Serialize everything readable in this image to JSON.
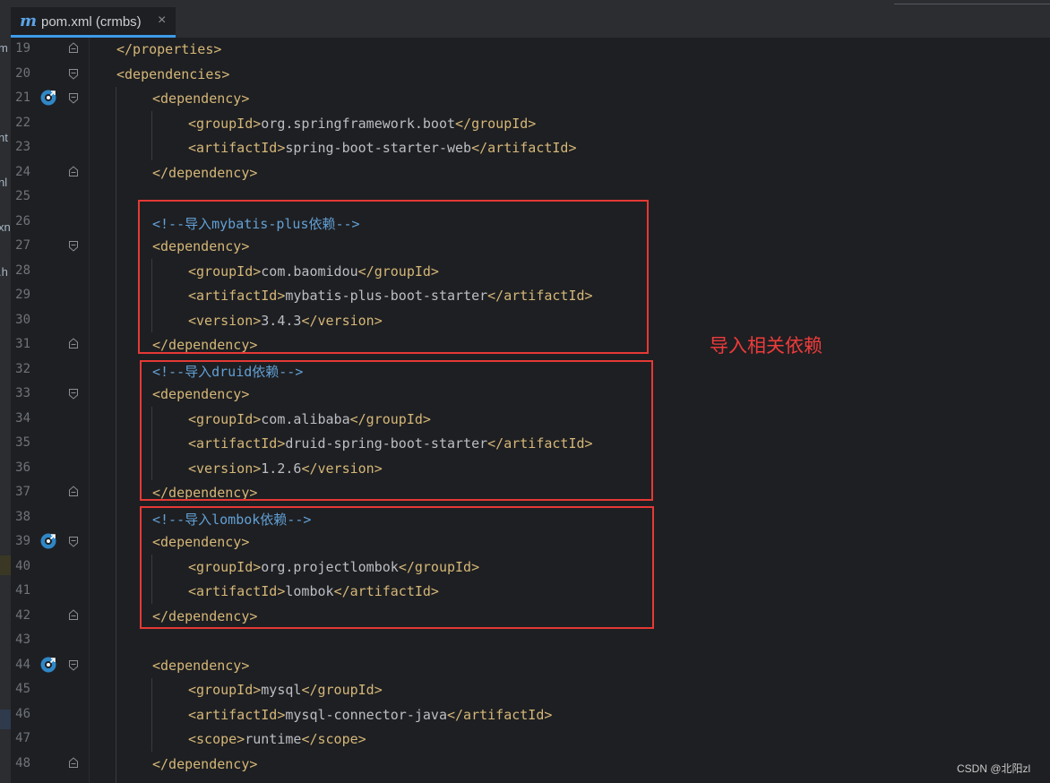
{
  "tab": {
    "icon": "maven-m-icon",
    "letter": "m",
    "label": "pom.xml (crmbs)",
    "close": "×"
  },
  "left_fragments": [
    "m",
    "nt",
    "nl",
    "xn",
    ".h"
  ],
  "lines": [
    {
      "n": "19",
      "fold": "end",
      "indent": 1,
      "parts": [
        [
          "tag",
          "</properties>"
        ]
      ]
    },
    {
      "n": "20",
      "fold": "start",
      "indent": 1,
      "parts": [
        [
          "tag",
          "<dependencies>"
        ]
      ]
    },
    {
      "n": "21",
      "fold": "start",
      "mark": true,
      "indent": 2,
      "parts": [
        [
          "tag",
          "<dependency>"
        ]
      ]
    },
    {
      "n": "22",
      "indent": 3,
      "parts": [
        [
          "tag",
          "<groupId>"
        ],
        [
          "txt",
          "org.springframework.boot"
        ],
        [
          "tag",
          "</groupId>"
        ]
      ]
    },
    {
      "n": "23",
      "indent": 3,
      "parts": [
        [
          "tag",
          "<artifactId>"
        ],
        [
          "txt",
          "spring-boot-starter-web"
        ],
        [
          "tag",
          "</artifactId>"
        ]
      ]
    },
    {
      "n": "24",
      "fold": "end",
      "indent": 2,
      "parts": [
        [
          "tag",
          "</dependency>"
        ]
      ]
    },
    {
      "n": "25",
      "indent": 0,
      "parts": []
    },
    {
      "n": "26",
      "indent": 2,
      "parts": [
        [
          "cmt",
          "<!--导入mybatis-plus依赖-->"
        ]
      ]
    },
    {
      "n": "27",
      "fold": "start",
      "indent": 2,
      "parts": [
        [
          "tag",
          "<dependency>"
        ]
      ]
    },
    {
      "n": "28",
      "indent": 3,
      "parts": [
        [
          "tag",
          "<groupId>"
        ],
        [
          "txt",
          "com.baomidou"
        ],
        [
          "tag",
          "</groupId>"
        ]
      ]
    },
    {
      "n": "29",
      "indent": 3,
      "parts": [
        [
          "tag",
          "<artifactId>"
        ],
        [
          "txt",
          "mybatis-plus-boot-starter"
        ],
        [
          "tag",
          "</artifactId>"
        ]
      ]
    },
    {
      "n": "30",
      "indent": 3,
      "parts": [
        [
          "tag",
          "<version>"
        ],
        [
          "txt",
          "3.4.3"
        ],
        [
          "tag",
          "</version>"
        ]
      ]
    },
    {
      "n": "31",
      "fold": "end",
      "indent": 2,
      "parts": [
        [
          "tag",
          "</dependency>"
        ]
      ]
    },
    {
      "n": "32",
      "indent": 2,
      "parts": [
        [
          "cmt",
          "<!--导入druid依赖-->"
        ]
      ]
    },
    {
      "n": "33",
      "fold": "start",
      "indent": 2,
      "parts": [
        [
          "tag",
          "<dependency>"
        ]
      ]
    },
    {
      "n": "34",
      "indent": 3,
      "parts": [
        [
          "tag",
          "<groupId>"
        ],
        [
          "txt",
          "com.alibaba"
        ],
        [
          "tag",
          "</groupId>"
        ]
      ]
    },
    {
      "n": "35",
      "indent": 3,
      "parts": [
        [
          "tag",
          "<artifactId>"
        ],
        [
          "txt",
          "druid-spring-boot-starter"
        ],
        [
          "tag",
          "</artifactId>"
        ]
      ]
    },
    {
      "n": "36",
      "indent": 3,
      "parts": [
        [
          "tag",
          "<version>"
        ],
        [
          "txt",
          "1.2.6"
        ],
        [
          "tag",
          "</version>"
        ]
      ]
    },
    {
      "n": "37",
      "fold": "end",
      "indent": 2,
      "parts": [
        [
          "tag",
          "</dependency>"
        ]
      ]
    },
    {
      "n": "38",
      "indent": 2,
      "parts": [
        [
          "cmt",
          "<!--导入lombok依赖-->"
        ]
      ]
    },
    {
      "n": "39",
      "fold": "start",
      "mark": true,
      "indent": 2,
      "parts": [
        [
          "tag",
          "<dependency>"
        ]
      ]
    },
    {
      "n": "40",
      "indent": 3,
      "parts": [
        [
          "tag",
          "<groupId>"
        ],
        [
          "txt",
          "org.projectlombok"
        ],
        [
          "tag",
          "</groupId>"
        ]
      ]
    },
    {
      "n": "41",
      "indent": 3,
      "parts": [
        [
          "tag",
          "<artifactId>"
        ],
        [
          "txt",
          "lombok"
        ],
        [
          "tag",
          "</artifactId>"
        ]
      ]
    },
    {
      "n": "42",
      "fold": "end",
      "indent": 2,
      "parts": [
        [
          "tag",
          "</dependency>"
        ]
      ]
    },
    {
      "n": "43",
      "indent": 0,
      "parts": []
    },
    {
      "n": "44",
      "fold": "start",
      "mark": true,
      "indent": 2,
      "parts": [
        [
          "tag",
          "<dependency>"
        ]
      ]
    },
    {
      "n": "45",
      "indent": 3,
      "parts": [
        [
          "tag",
          "<groupId>"
        ],
        [
          "txt",
          "mysql"
        ],
        [
          "tag",
          "</groupId>"
        ]
      ]
    },
    {
      "n": "46",
      "indent": 3,
      "parts": [
        [
          "tag",
          "<artifactId>"
        ],
        [
          "txt",
          "mysql-connector-java"
        ],
        [
          "tag",
          "</artifactId>"
        ]
      ]
    },
    {
      "n": "47",
      "indent": 3,
      "parts": [
        [
          "tag",
          "<scope>"
        ],
        [
          "txt",
          "runtime"
        ],
        [
          "tag",
          "</scope>"
        ]
      ]
    },
    {
      "n": "48",
      "fold": "end",
      "indent": 2,
      "parts": [
        [
          "tag",
          "</dependency>"
        ]
      ]
    }
  ],
  "annotation": {
    "label": "导入相关依赖",
    "color": "#e53935"
  },
  "watermark": "CSDN @北阳zl",
  "colors": {
    "tag": "#d5b778",
    "text": "#bcbec4",
    "comment": "#62a0d5",
    "editor_bg": "#1e1f22",
    "marker": "#2f87c6"
  }
}
